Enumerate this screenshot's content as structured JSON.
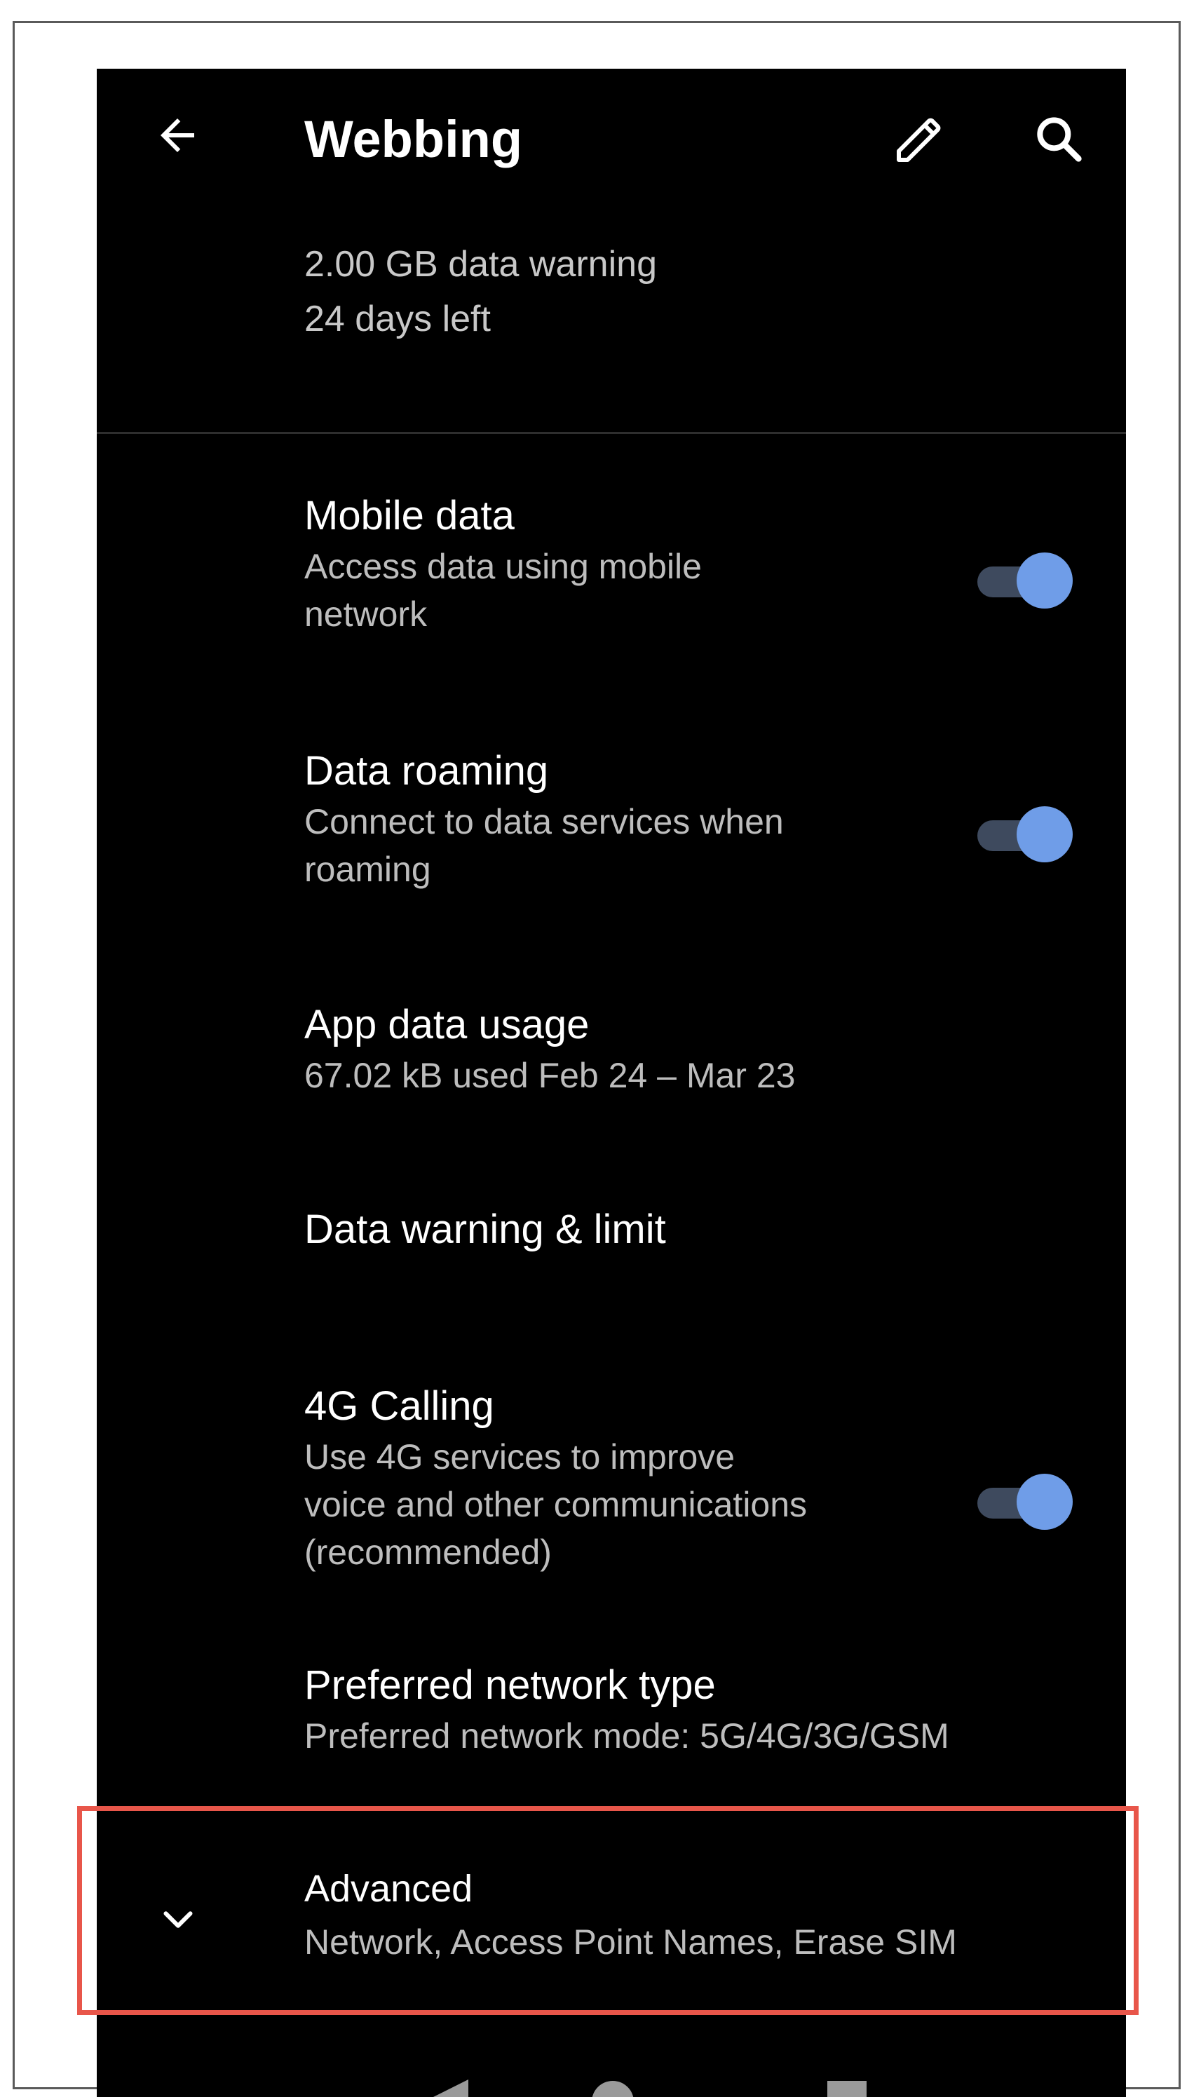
{
  "header": {
    "title": "Webbing",
    "back_icon": "arrow-back-icon",
    "edit_icon": "pencil-icon",
    "search_icon": "search-icon"
  },
  "usage_summary": {
    "warning": "2.00 GB data warning",
    "days_left": "24 days left"
  },
  "settings": {
    "mobile_data": {
      "title": "Mobile data",
      "subtitle_line1": "Access data using mobile",
      "subtitle_line2": "network",
      "enabled": true
    },
    "data_roaming": {
      "title": "Data roaming",
      "subtitle_line1": "Connect to data services when",
      "subtitle_line2": "roaming",
      "enabled": true
    },
    "app_data_usage": {
      "title": "App data usage",
      "subtitle": "67.02 kB used Feb 24 – Mar 23"
    },
    "data_warning_limit": {
      "title": "Data warning & limit"
    },
    "calling_4g": {
      "title": "4G Calling",
      "subtitle_line1": "Use 4G services to improve",
      "subtitle_line2": "voice and other communications",
      "subtitle_line3": "(recommended)",
      "enabled": true
    },
    "preferred_network": {
      "title": "Preferred network type",
      "subtitle": "Preferred network mode: 5G/4G/3G/GSM"
    },
    "advanced": {
      "title": "Advanced",
      "subtitle": "Network, Access Point Names, Erase SIM",
      "icon": "chevron-down-icon"
    }
  },
  "colors": {
    "background": "#000000",
    "toggle_thumb": "#6f9de8",
    "toggle_track": "#3e4a5e",
    "highlight": "#e8564a"
  }
}
